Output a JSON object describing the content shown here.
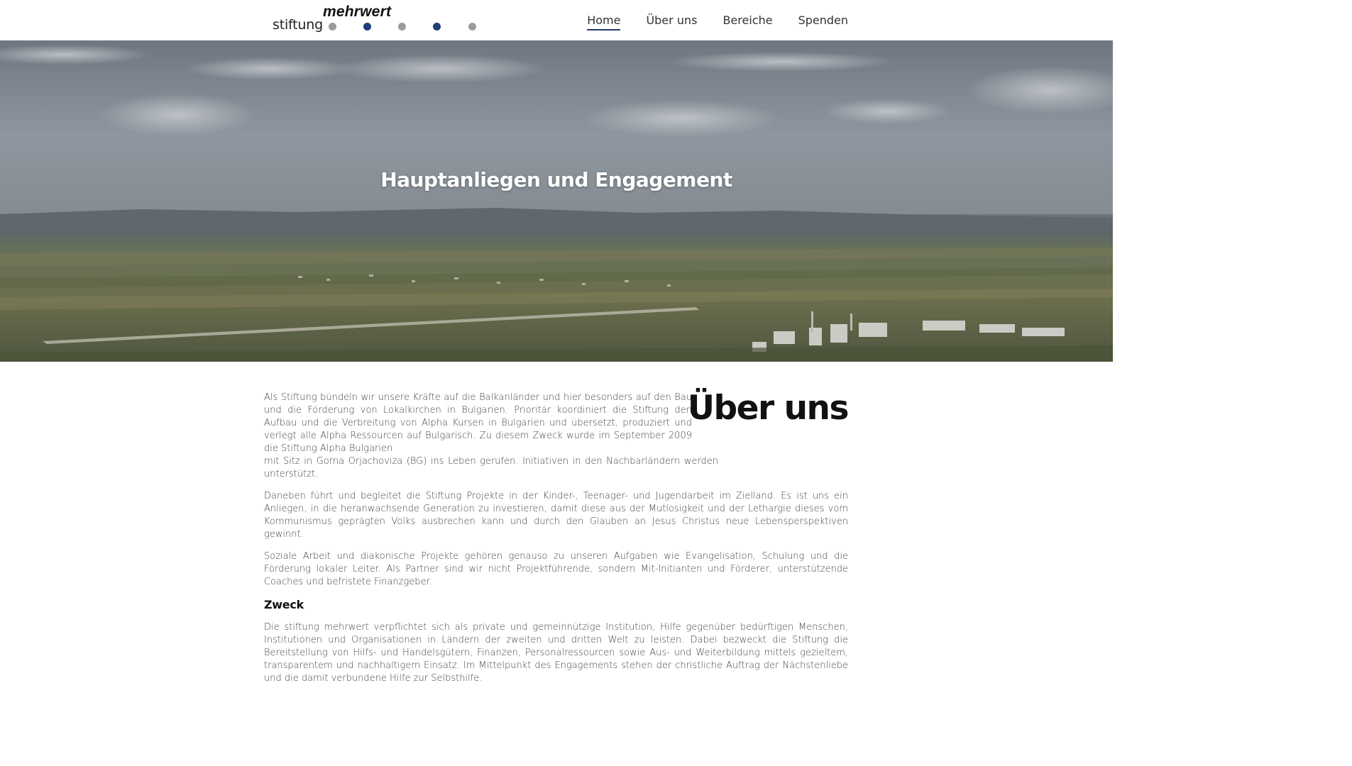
{
  "header": {
    "logo": {
      "word_small": "stiftung",
      "word_bold": "mehrwert",
      "dots": [
        {
          "color": "#9b9b9b"
        },
        {
          "color": "#1f3e7a"
        },
        {
          "color": "#9b9b9b"
        },
        {
          "color": "#1f3e7a"
        },
        {
          "color": "#9b9b9b"
        }
      ]
    },
    "nav": [
      {
        "label": "Home",
        "active": true
      },
      {
        "label": "Über uns",
        "active": false
      },
      {
        "label": "Bereiche",
        "active": false
      },
      {
        "label": "Spenden",
        "active": false
      }
    ]
  },
  "hero": {
    "title": "Hauptanliegen und Engagement"
  },
  "about": {
    "heading": "Über uns",
    "paragraphs": [
      "Als Stiftung bündeln wir unsere Kräfte auf die Balkanländer und hier besonders auf den Bau und die Förderung von Lokalkirchen in Bulgarien. Prioritär koordiniert die Stiftung den Aufbau und die Verbreitung von Alpha Kursen in Bulgarien und übersetzt, produziert und verlegt alle Alpha Ressourcen auf Bulgarisch. Zu diesem Zweck wurde im September 2009 die Stiftung Alpha Bulgarien",
      "mit Sitz in Gorna Orjachoviza (BG) ins Leben gerufen. Initiativen in den Nachbarländern werden unterstützt.",
      "Daneben führt und begleitet die Stiftung Projekte in der Kinder-, Teenager- und Jugendarbeit im Zielland. Es ist uns ein Anliegen, in die heranwachsende Generation zu investieren, damit diese aus der Mutlosigkeit und der Lethargie dieses vom Kommunismus geprägten Volks ausbrechen kann und durch den Glauben an Jesus Christus neue Lebensperspektiven gewinnt.",
      "Soziale Arbeit und diakonische Projekte gehören genauso zu unseren Aufgaben wie Evangelisation, Schulung und die Förderung lokaler Leiter. Als Partner sind wir nicht Projektführende, sondern Mit-Initianten und Förderer, unterstützende Coaches und befristete Finanzgeber."
    ]
  },
  "zweck": {
    "heading": "Zweck",
    "paragraph": "Die stiftung mehrwert verpflichtet sich als private und gemeinnützige Institution, Hilfe gegenüber bedürftigen Menschen, Institutionen und Organisationen in Ländern der zweiten und dritten Welt zu leisten. Dabei bezweckt die Stiftung die Bereitstellung von Hilfs- und Handelsgütern, Finanzen, Personalressourcen sowie Aus- und Weiterbildung mittels gezieltem, transparentem und nachhaltigem Einsatz. Im Mittelpunkt des Engagements stehen der christliche Auftrag der Nächstenliebe und die damit verbundene Hilfe zur Selbsthilfe."
  }
}
